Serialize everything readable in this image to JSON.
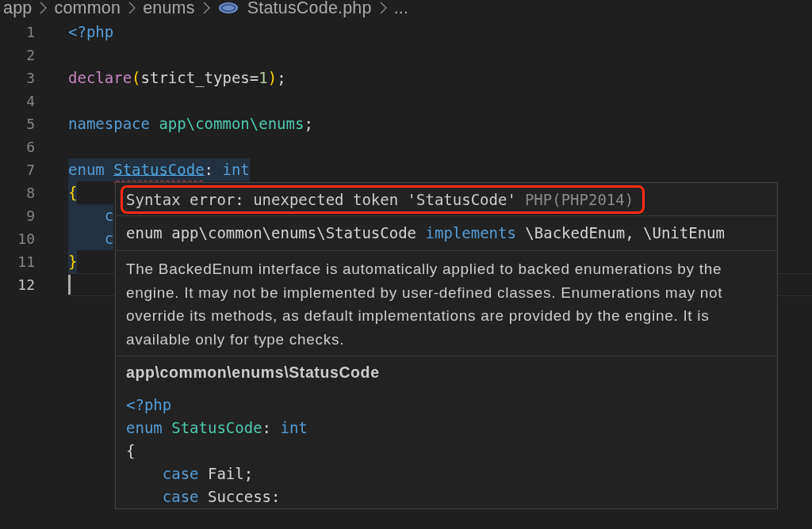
{
  "breadcrumb": {
    "items": [
      {
        "label": "app",
        "kind": "folder"
      },
      {
        "label": "common",
        "kind": "folder"
      },
      {
        "label": "enums",
        "kind": "folder"
      },
      {
        "label": "StatusCode.php",
        "kind": "file"
      },
      {
        "label": "...",
        "kind": "more"
      }
    ]
  },
  "editor": {
    "lines": [
      {
        "number": "1",
        "highlighted": false,
        "active": false,
        "tokens": [
          {
            "text": "<?php",
            "kind": "tag"
          }
        ]
      },
      {
        "number": "2",
        "highlighted": false,
        "active": false
      },
      {
        "number": "3",
        "highlighted": false,
        "active": false,
        "tokens": [
          {
            "text": "declare",
            "kind": "control"
          },
          {
            "text": "(",
            "kind": "bracket"
          },
          {
            "text": "strict_types=",
            "kind": "plain"
          },
          {
            "text": "1",
            "kind": "number"
          },
          {
            "text": ")",
            "kind": "bracket"
          },
          {
            "text": ";",
            "kind": "plain"
          }
        ]
      },
      {
        "number": "4",
        "highlighted": false,
        "active": false
      },
      {
        "number": "5",
        "highlighted": false,
        "active": false,
        "tokens": [
          {
            "text": "namespace",
            "kind": "keyword"
          },
          {
            "text": " app\\common\\enums",
            "kind": "namespace"
          },
          {
            "text": ";",
            "kind": "plain"
          }
        ]
      },
      {
        "number": "6",
        "highlighted": false,
        "active": false
      },
      {
        "number": "7",
        "highlighted": true,
        "active": false,
        "tokens": [
          {
            "text": "enum ",
            "kind": "keyword"
          },
          {
            "text": "StatusCode",
            "kind": "invalid"
          },
          {
            "text": ": ",
            "kind": "plain"
          },
          {
            "text": "int",
            "kind": "keyword"
          }
        ]
      },
      {
        "number": "8",
        "highlighted": true,
        "active": false,
        "tokens": [
          {
            "text": "{",
            "kind": "bracket"
          }
        ]
      },
      {
        "number": "9",
        "highlighted": true,
        "active": false,
        "tokens": [
          {
            "text": "    c",
            "kind": "keyword"
          }
        ]
      },
      {
        "number": "10",
        "highlighted": true,
        "active": false,
        "tokens": [
          {
            "text": "    c",
            "kind": "keyword"
          }
        ]
      },
      {
        "number": "11",
        "highlighted": true,
        "active": false,
        "tokens": [
          {
            "text": "}",
            "kind": "bracket"
          }
        ]
      },
      {
        "number": "12",
        "highlighted": false,
        "active": true
      }
    ]
  },
  "hover": {
    "error": {
      "message": "Syntax error: unexpected token 'StatusCode'",
      "source": "PHP(PHP2014)",
      "outlined": true
    },
    "signature": [
      {
        "text": "enum app\\common\\enums\\StatusCode ",
        "kind": "plain"
      },
      {
        "text": "implements",
        "kind": "keyword"
      },
      {
        "text": " \\BackedEnum, \\UnitEnum",
        "kind": "plain"
      }
    ],
    "description": "The BackedEnum interface is automatically applied to backed enumerations by the engine. It may not be implemented by user-defined classes. Enumerations may not override its methods, as default implementations are provided by the engine. It is available only for type checks.",
    "heading": "app\\common\\enums\\StatusCode",
    "code": [
      {
        "tokens": [
          {
            "text": "<?php",
            "kind": "tag"
          }
        ]
      },
      {
        "tokens": [
          {
            "text": "enum ",
            "kind": "keyword"
          },
          {
            "text": "StatusCode",
            "kind": "type"
          },
          {
            "text": ": ",
            "kind": "plain"
          },
          {
            "text": "int",
            "kind": "keyword"
          }
        ]
      },
      {
        "tokens": [
          {
            "text": "{",
            "kind": "plain"
          }
        ]
      },
      {
        "tokens": [
          {
            "text": "    case",
            "kind": "keyword"
          },
          {
            "text": " Fail;",
            "kind": "plain"
          }
        ]
      },
      {
        "tokens": [
          {
            "text": "    case",
            "kind": "keyword"
          },
          {
            "text": " Success:",
            "kind": "plain"
          }
        ]
      }
    ]
  }
}
